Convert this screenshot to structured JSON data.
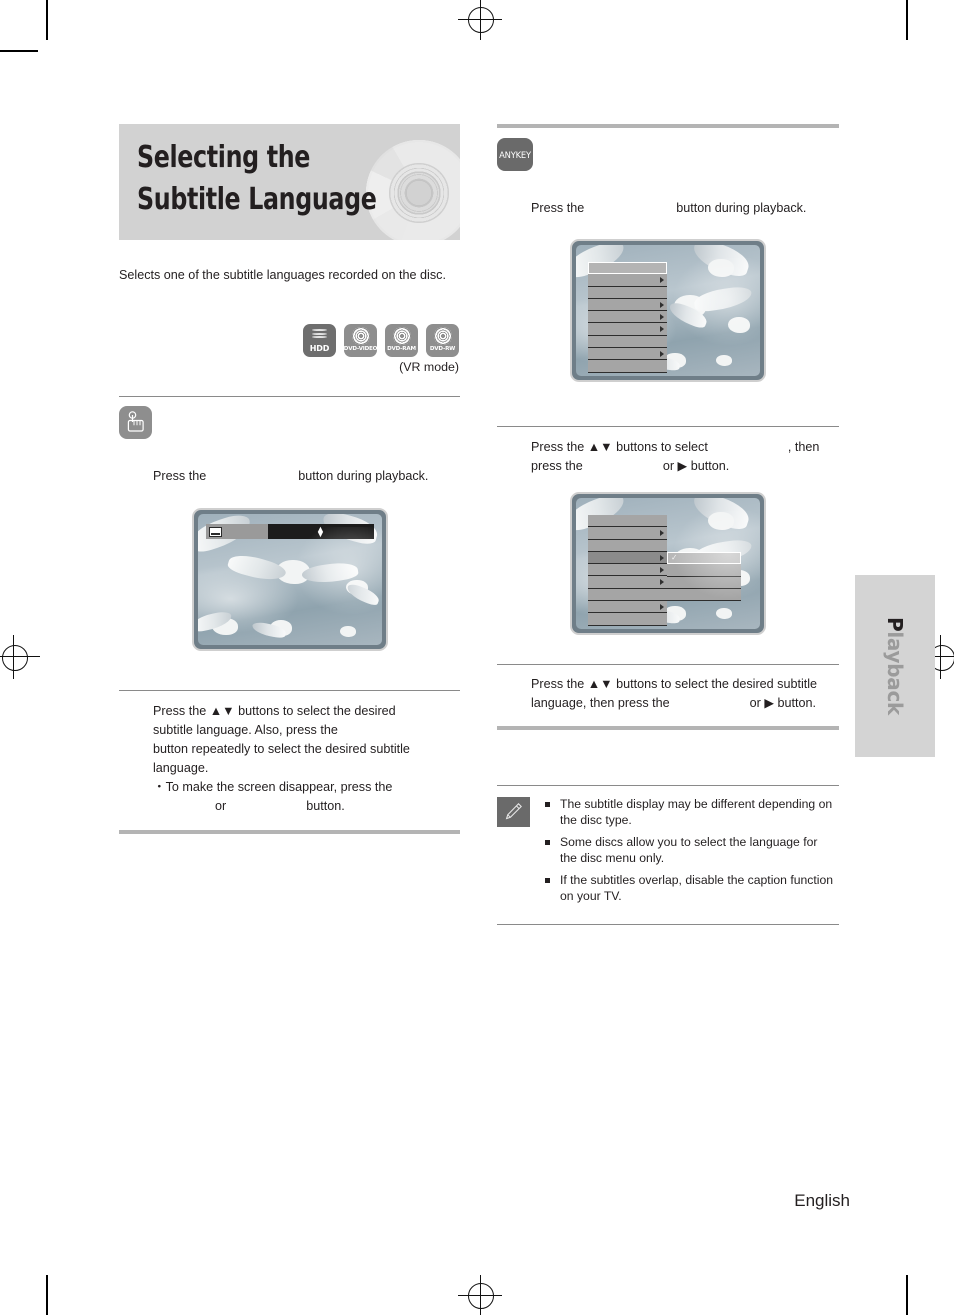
{
  "header": {
    "title": "Selecting the Subtitle Language"
  },
  "intro": {
    "text": "Selects one of the subtitle languages recorded on the disc."
  },
  "disc_icons": [
    {
      "name": "HDD",
      "label": "HDD",
      "style": "dark"
    },
    {
      "name": "DVD-VIDEO",
      "label": "DVD-VIDEO",
      "style": "light"
    },
    {
      "name": "DVD-RAM",
      "label": "DVD-RAM",
      "style": "light"
    },
    {
      "name": "DVD-RW",
      "label": "DVD-RW",
      "style": "light"
    }
  ],
  "vr_mode_note": "(VR mode)",
  "left_column": {
    "step1": {
      "badge": "press-button-icon",
      "text_before": "Press the",
      "text_after": "button during playback."
    },
    "screenshot": {
      "caption": "tv-screen-subtitle-osd",
      "osd": {
        "icon": "subtitle-icon",
        "indicator": "up-down-arrows"
      }
    },
    "step2": {
      "line1": "Press the ▲▼ buttons to select the desired",
      "line2_before": "subtitle language. Also, press the",
      "line3": "button repeatedly to select the desired subtitle",
      "line4": "language.",
      "bullet_prefix": "・",
      "bullet_line1": "To make the screen disappear, press the",
      "bullet_or": "or",
      "bullet_end": "button."
    }
  },
  "right_column": {
    "step1": {
      "badge": "ANYKEY",
      "text_before": "Press the",
      "text_after": "button during playback."
    },
    "screenshot1": {
      "caption": "tv-screen-anykey-menu",
      "menu_rows": 9,
      "selected_row": 1,
      "rows_with_arrow": [
        2,
        4,
        5,
        6,
        8
      ]
    },
    "step2": {
      "line1_before": "Press the ▲▼ buttons to select",
      "line1_after": ", then",
      "line2_before": "press the",
      "line2_or": "or ▶ button."
    },
    "screenshot2": {
      "caption": "tv-screen-anykey-submenu",
      "menu_rows": 9,
      "active_row": 4,
      "rows_with_arrow": [
        2,
        4,
        5,
        6,
        8
      ],
      "submenu_rows": 4,
      "submenu_selected": 1,
      "submenu_check": "✓"
    },
    "step3": {
      "line1": "Press the ▲▼ buttons to select the desired subtitle",
      "line2_before": "language, then press the",
      "line2_after": "or ▶ button."
    },
    "notes": {
      "badge": "note-pencil-icon",
      "items": [
        "The subtitle display may be different depending on the disc type.",
        "Some discs allow you to select the language for the disc menu only.",
        "If the subtitles overlap, disable the caption function on your TV."
      ]
    }
  },
  "side_tab": {
    "initial": "P",
    "rest": "layback"
  },
  "footer": {
    "page_number": "",
    "language": "English"
  }
}
